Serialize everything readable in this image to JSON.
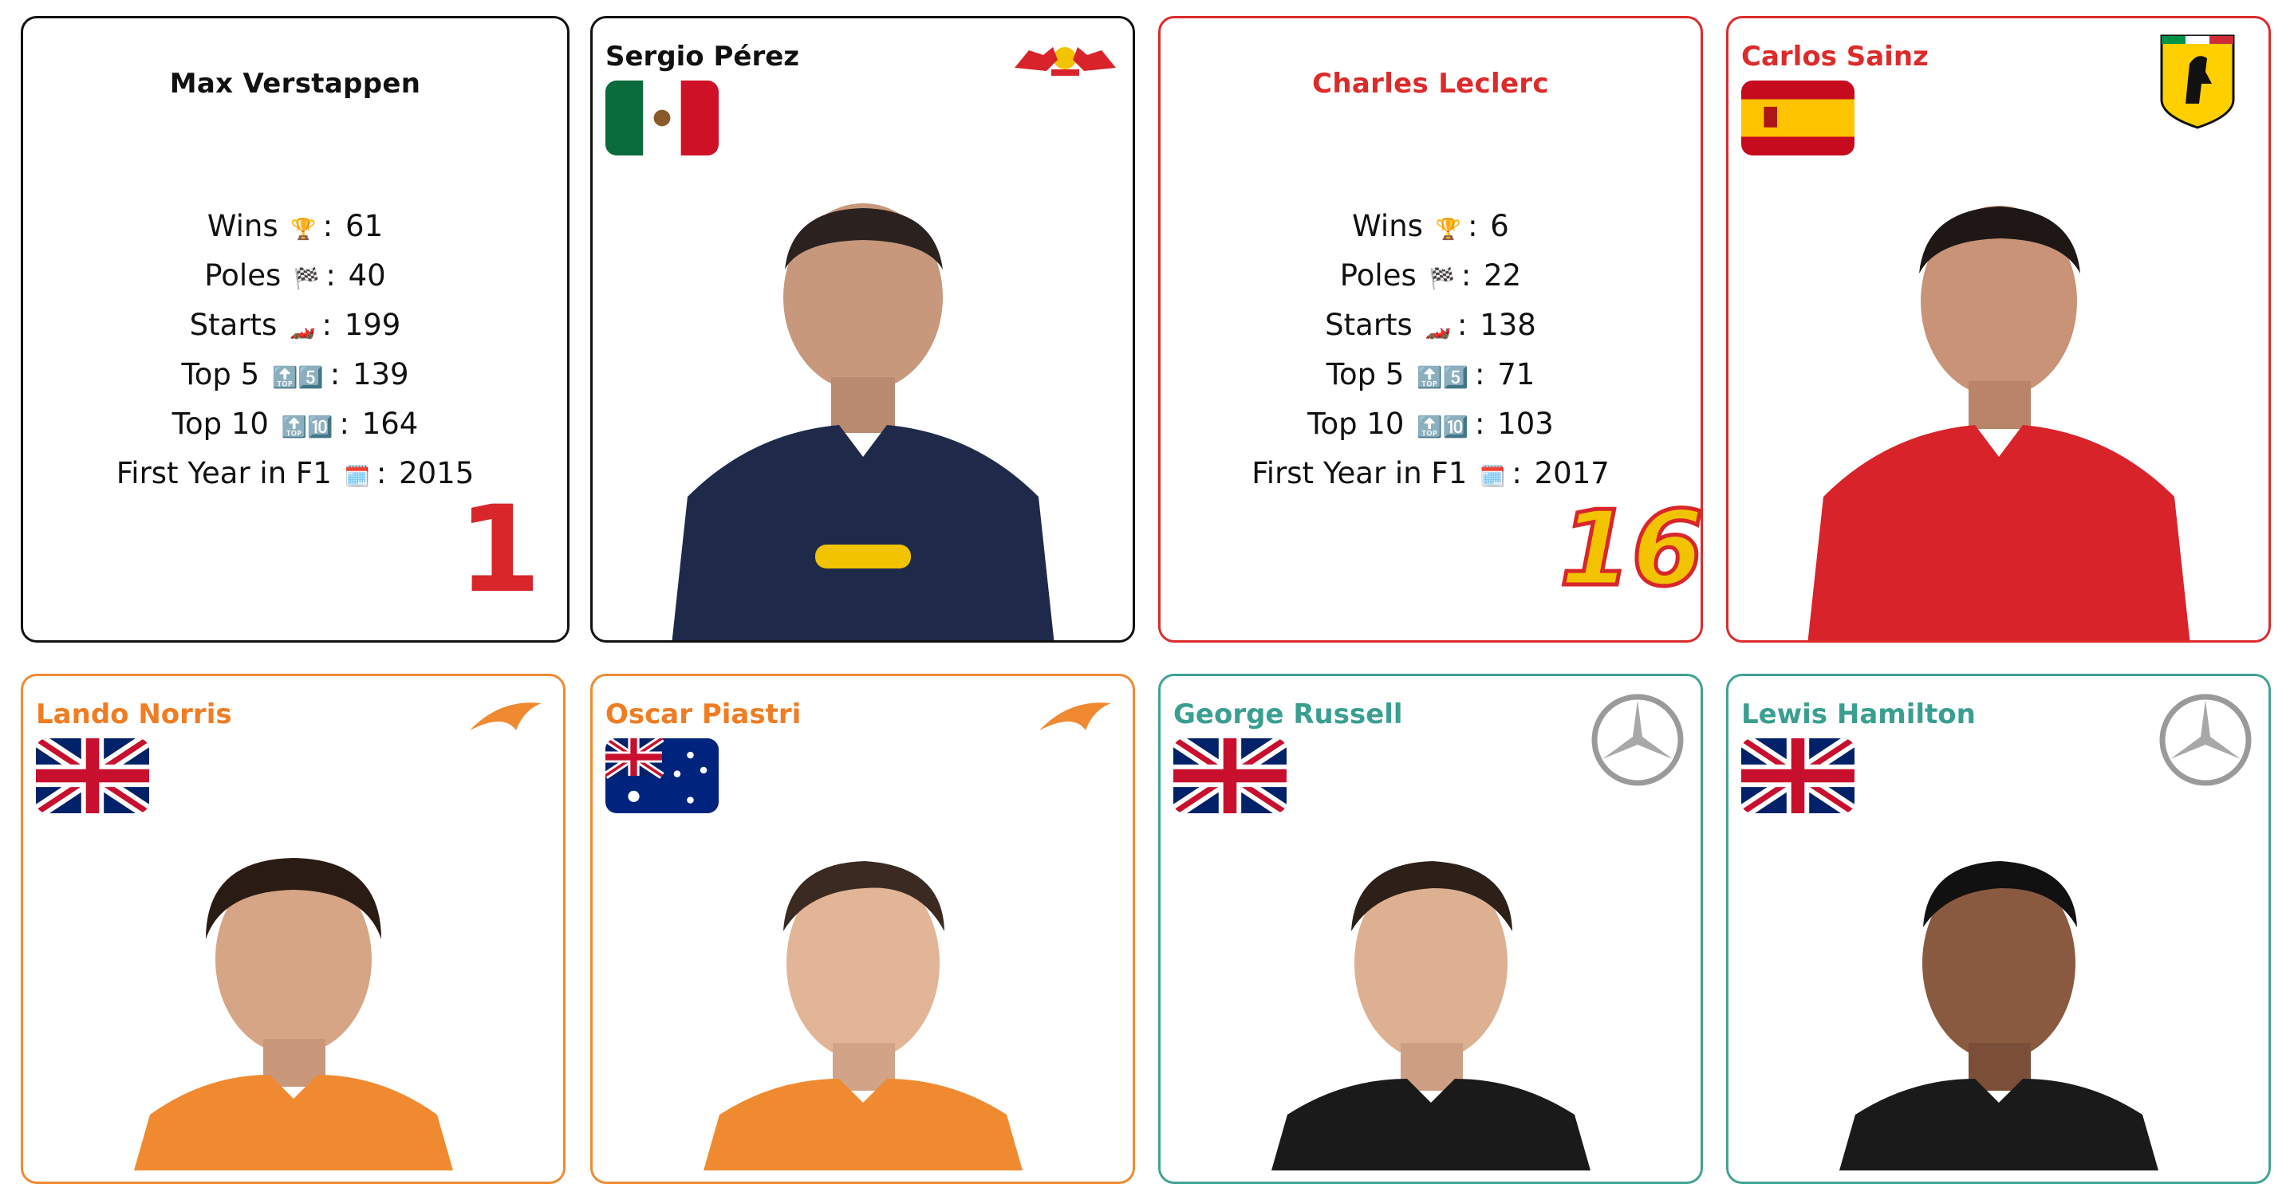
{
  "cards": {
    "verstappen": {
      "name": "Max Verstappen",
      "number": "1",
      "stats": [
        {
          "label": "Wins",
          "emoji": "🏆",
          "value": "61"
        },
        {
          "label": "Poles",
          "emoji": "🏁",
          "value": "40"
        },
        {
          "label": "Starts",
          "emoji": "🏎️",
          "value": "199"
        },
        {
          "label": "Top 5",
          "emoji": "🔝5️⃣",
          "value": "139"
        },
        {
          "label": "Top 10",
          "emoji": "🔝🔟",
          "value": "164"
        },
        {
          "label": "First Year in F1",
          "emoji": "🗓️",
          "value": "2015"
        }
      ]
    },
    "perez": {
      "name": "Sergio Pérez",
      "flag": "mexico-flag",
      "logo": "red-bull-logo"
    },
    "leclerc": {
      "name": "Charles Leclerc",
      "number": "16",
      "stats": [
        {
          "label": "Wins",
          "emoji": "🏆",
          "value": "6"
        },
        {
          "label": "Poles",
          "emoji": "🏁",
          "value": "22"
        },
        {
          "label": "Starts",
          "emoji": "🏎️",
          "value": "138"
        },
        {
          "label": "Top 5",
          "emoji": "🔝5️⃣",
          "value": "71"
        },
        {
          "label": "Top 10",
          "emoji": "🔝🔟",
          "value": "103"
        },
        {
          "label": "First Year in F1",
          "emoji": "🗓️",
          "value": "2017"
        }
      ]
    },
    "sainz": {
      "name": "Carlos Sainz",
      "flag": "spain-flag",
      "logo": "ferrari-logo"
    },
    "norris": {
      "name": "Lando Norris",
      "flag": "uk-flag",
      "logo": "mclaren-logo"
    },
    "piastri": {
      "name": "Oscar Piastri",
      "flag": "australia-flag",
      "logo": "mclaren-logo"
    },
    "russell": {
      "name": "George Russell",
      "flag": "uk-flag",
      "logo": "mercedes-logo"
    },
    "hamilton": {
      "name": "Lewis Hamilton",
      "flag": "uk-flag",
      "logo": "mercedes-logo"
    }
  },
  "colors": {
    "redbull": "#111111",
    "ferrari": "#dc2b2b",
    "mclaren": "#f08a31",
    "mercedes": "#3fa394"
  }
}
